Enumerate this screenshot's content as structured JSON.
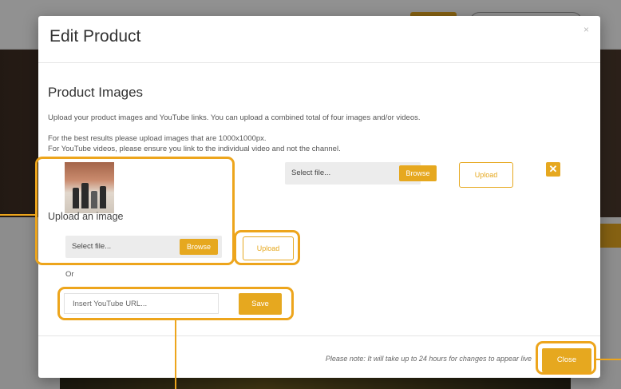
{
  "modal": {
    "title": "Edit Product",
    "close_glyph": "×"
  },
  "images_section": {
    "title": "Product Images",
    "description_1": "Upload your product images and YouTube links. You can upload a combined total of four images and/or videos.",
    "description_2": "For the best results please upload images that are 1000x1000px.",
    "description_3": "For YouTube videos, please ensure you link to the individual video and not the channel."
  },
  "existing_image": {
    "file_label": "Select file...",
    "browse_label": "Browse",
    "upload_label": "Upload",
    "remove_icon": "close-icon",
    "remove_glyph": "✕"
  },
  "new_image": {
    "upload_label": "Upload an image",
    "file_label": "Select file...",
    "browse_label": "Browse",
    "upload_button": "Upload"
  },
  "or_label": "Or",
  "youtube": {
    "placeholder": "Insert YouTube URL...",
    "save_label": "Save"
  },
  "footer": {
    "note": "Please note: It will take up to 24 hours for changes to appear live",
    "close_label": "Close"
  },
  "colors": {
    "accent": "#e6a81f",
    "highlight": "#eda51c"
  }
}
